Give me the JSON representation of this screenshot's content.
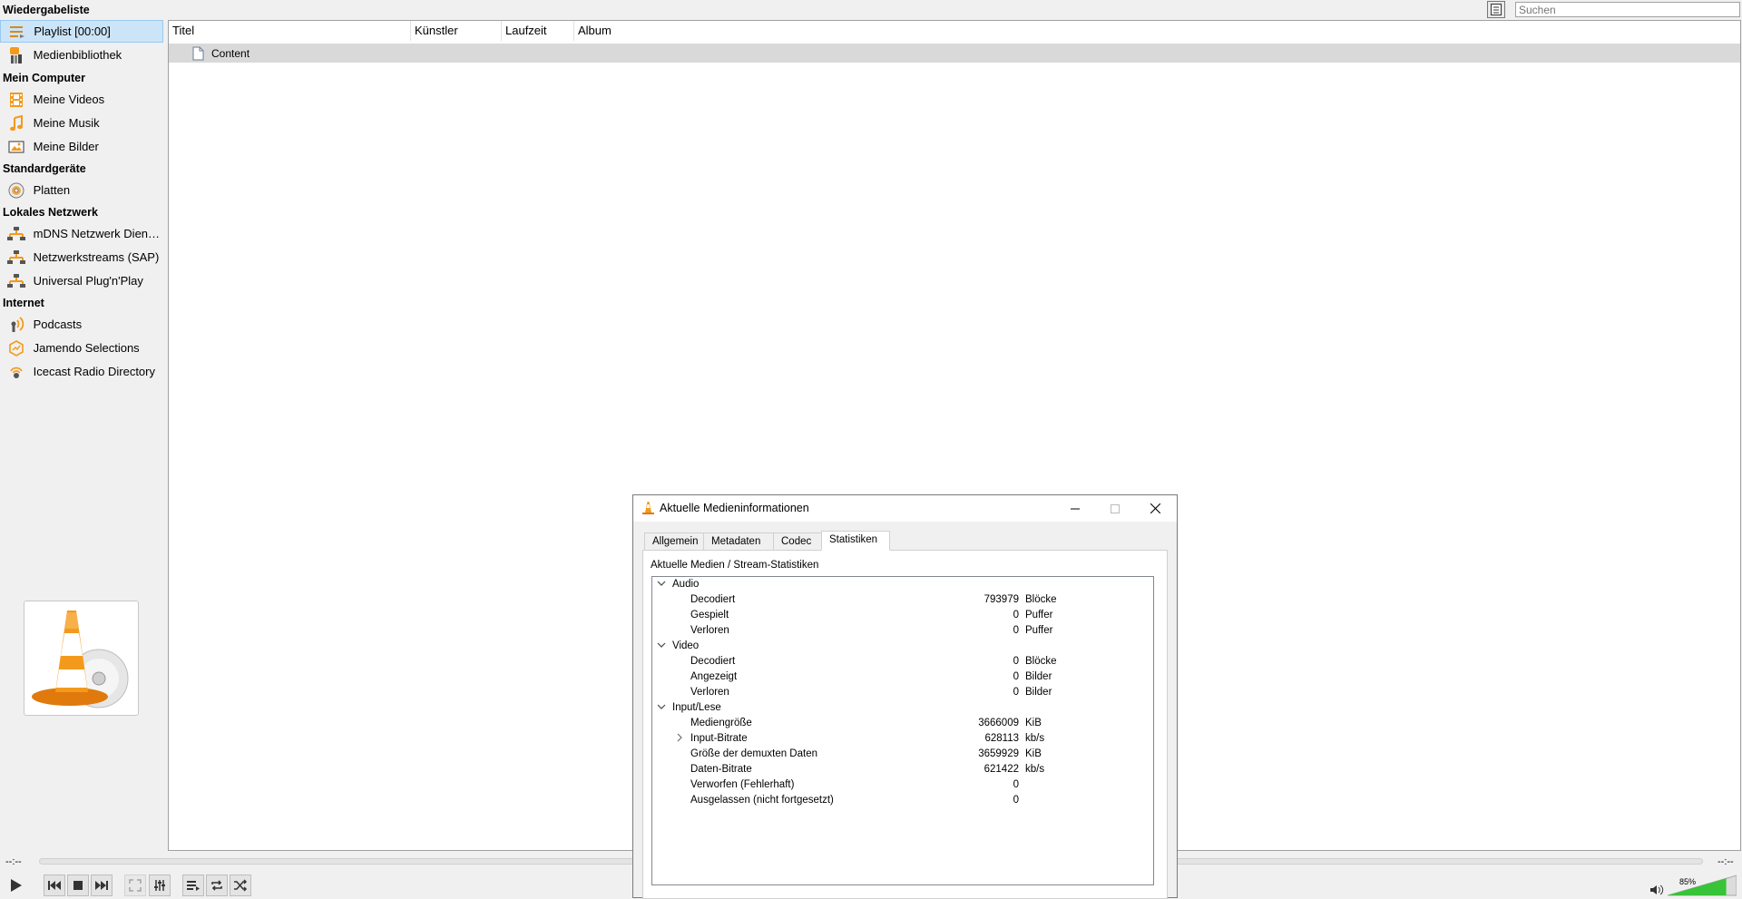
{
  "sidebar": {
    "sections": [
      {
        "title": "Wiedergabeliste",
        "items": [
          {
            "label": "Playlist [00:00]",
            "icon": "playlist-icon",
            "selected": true
          },
          {
            "label": "Medienbibliothek",
            "icon": "media-library-icon"
          }
        ]
      },
      {
        "title": "Mein Computer",
        "items": [
          {
            "label": "Meine Videos",
            "icon": "film-icon"
          },
          {
            "label": "Meine Musik",
            "icon": "music-note-icon"
          },
          {
            "label": "Meine Bilder",
            "icon": "picture-icon"
          }
        ]
      },
      {
        "title": "Standardgeräte",
        "items": [
          {
            "label": "Platten",
            "icon": "disc-icon"
          }
        ]
      },
      {
        "title": "Lokales Netzwerk",
        "items": [
          {
            "label": "mDNS Netzwerk Dienster...",
            "icon": "network-icon"
          },
          {
            "label": "Netzwerkstreams (SAP)",
            "icon": "network-icon"
          },
          {
            "label": "Universal Plug'n'Play",
            "icon": "network-icon"
          }
        ]
      },
      {
        "title": "Internet",
        "items": [
          {
            "label": "Podcasts",
            "icon": "podcast-icon"
          },
          {
            "label": "Jamendo Selections",
            "icon": "jamendo-icon"
          },
          {
            "label": "Icecast Radio Directory",
            "icon": "icecast-icon"
          }
        ]
      }
    ]
  },
  "search": {
    "placeholder": "Suchen"
  },
  "playlist": {
    "columns": [
      "Titel",
      "Künstler",
      "Laufzeit",
      "Album"
    ],
    "rows": [
      {
        "title": "Content"
      }
    ]
  },
  "controls": {
    "elapsed": "--:--",
    "remaining": "--:--",
    "volume_percent": "85%",
    "volume_level": 0.85
  },
  "dialog": {
    "title": "Aktuelle Medieninformationen",
    "tabs": [
      "Allgemein",
      "Metadaten",
      "Codec",
      "Statistiken"
    ],
    "active_tab": "Statistiken",
    "panel_label": "Aktuelle Medien / Stream-Statistiken",
    "groups": [
      {
        "name": "Audio",
        "rows": [
          {
            "name": "Decodiert",
            "value": "793979",
            "unit": "Blöcke"
          },
          {
            "name": "Gespielt",
            "value": "0",
            "unit": "Puffer"
          },
          {
            "name": "Verloren",
            "value": "0",
            "unit": "Puffer"
          }
        ]
      },
      {
        "name": "Video",
        "rows": [
          {
            "name": "Decodiert",
            "value": "0",
            "unit": "Blöcke"
          },
          {
            "name": "Angezeigt",
            "value": "0",
            "unit": "Bilder"
          },
          {
            "name": "Verloren",
            "value": "0",
            "unit": "Bilder"
          }
        ]
      },
      {
        "name": "Input/Lese",
        "rows": [
          {
            "name": "Mediengröße",
            "value": "3666009",
            "unit": "KiB"
          },
          {
            "name": "Input-Bitrate",
            "value": "628113",
            "unit": "kb/s",
            "expandable": true
          },
          {
            "name": "Größe der demuxten Daten",
            "value": "3659929",
            "unit": "KiB"
          },
          {
            "name": "Daten-Bitrate",
            "value": "621422",
            "unit": "kb/s"
          },
          {
            "name": "Verworfen (Fehlerhaft)",
            "value": "0",
            "unit": ""
          },
          {
            "name": "Ausgelassen (nicht fortgesetzt)",
            "value": "0",
            "unit": ""
          }
        ]
      }
    ]
  },
  "colors": {
    "accent": "#ff8800",
    "selection": "#cce4f7",
    "volume": "#39c339"
  }
}
